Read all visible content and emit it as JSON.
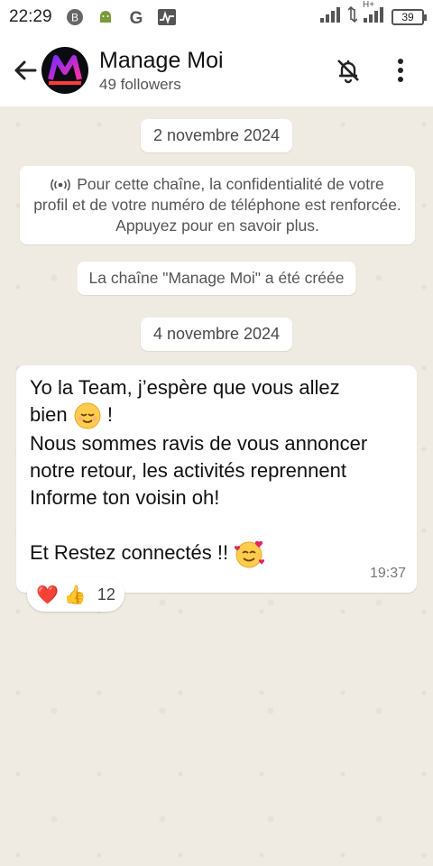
{
  "status_bar": {
    "time": "22:29",
    "battery": "39",
    "network_label": "H+"
  },
  "header": {
    "channel_name": "Manage Moi",
    "followers": "49 followers",
    "avatar_text": "MANAGE MOI"
  },
  "chat": {
    "date_1": "2 novembre 2024",
    "privacy_notice": "Pour cette chaîne, la confidentialité de votre profil et de votre numéro de téléphone est renforcée. Appuyez pour en savoir plus.",
    "channel_created": "La chaîne \"Manage Moi\" a été créée",
    "date_2": "4 novembre 2024",
    "message": {
      "line1": "Yo la Team, j’espère que vous allez",
      "line2": "bien",
      "line2_suffix": "!",
      "line3": "Nous sommes ravis de vous annoncer",
      "line4": "notre retour, les activités reprennent",
      "line5": "Informe ton voisin oh!",
      "line6": "Et Restez connectés !!",
      "time": "19:37"
    },
    "reactions": {
      "emojis": [
        "❤️",
        "👍"
      ],
      "count": "12"
    }
  },
  "colors": {
    "background": "#efeae2",
    "bubble": "#ffffff",
    "header": "#ffffff"
  }
}
